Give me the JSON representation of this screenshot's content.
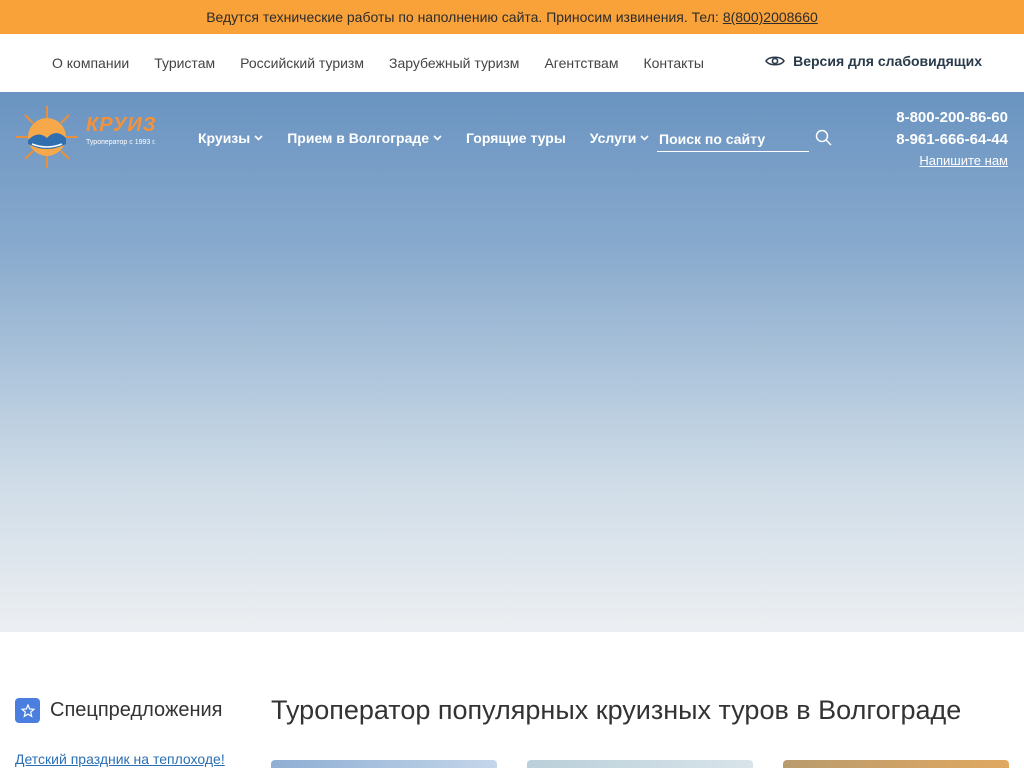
{
  "notice": {
    "text": "Ведутся технические работы по наполнению сайта. Приносим извинения. Тел:",
    "phone_link": "8(800)2008660"
  },
  "top_nav": {
    "links": [
      "О компании",
      "Туристам",
      "Российский туризм",
      "Зарубежный туризм",
      "Агентствам",
      "Контакты"
    ],
    "accessibility_label": "Версия для слабовидящих"
  },
  "logo": {
    "brand": "КРУИЗ",
    "tagline": "Туроператор с 1993 г."
  },
  "main_nav": {
    "items": [
      {
        "label": "Круизы",
        "has_dropdown": true
      },
      {
        "label": "Прием в Волгограде",
        "has_dropdown": true
      },
      {
        "label": "Горящие туры",
        "has_dropdown": false
      },
      {
        "label": "Услуги",
        "has_dropdown": true
      }
    ]
  },
  "search": {
    "placeholder": "Поиск по сайту",
    "icon": "search-icon"
  },
  "contacts": {
    "phone1": "8-800-200-86-60",
    "phone2": "8-961-666-64-44",
    "write_label": "Напишите нам"
  },
  "sidebar": {
    "title": "Спецпредложения",
    "icon": "star-icon",
    "links": [
      "Детский праздник на теплоходе!"
    ]
  },
  "main": {
    "heading": "Туроператор популярных круизных туров в Волгограде"
  },
  "colors": {
    "notice_bg": "#f9a23a",
    "brand_orange": "#f4923a",
    "accent_blue": "#4a7fe0",
    "link_blue": "#2a6fb5"
  }
}
